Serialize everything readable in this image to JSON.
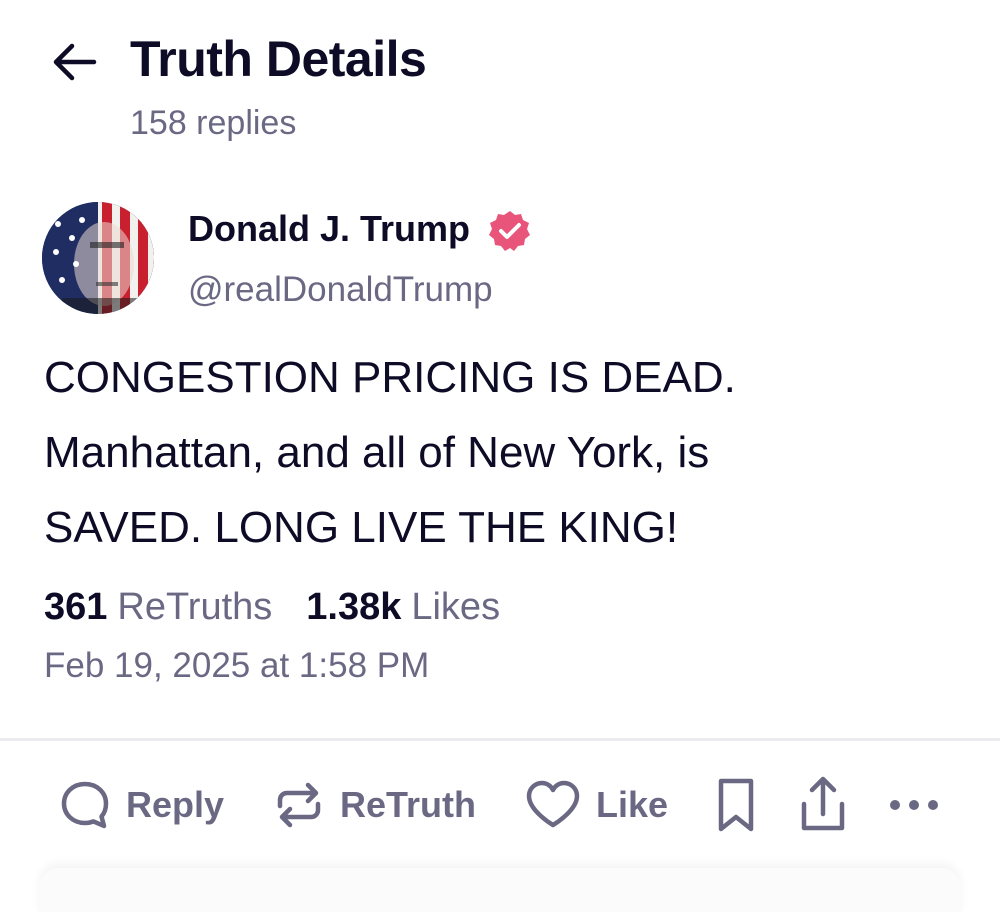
{
  "header": {
    "title": "Truth Details",
    "replies": "158 replies"
  },
  "author": {
    "name": "Donald J. Trump",
    "handle": "@realDonaldTrump",
    "verified_color": "#e8547a"
  },
  "post": {
    "lines": [
      "CONGESTION PRICING IS DEAD.",
      "Manhattan, and all of New York, is",
      "SAVED. LONG LIVE THE KING!"
    ]
  },
  "stats": {
    "retruths_count": "361",
    "retruths_label": "ReTruths",
    "likes_count": "1.38k",
    "likes_label": "Likes"
  },
  "timestamp": "Feb 19, 2025 at 1:58 PM",
  "actions": {
    "reply": "Reply",
    "retruth": "ReTruth",
    "like": "Like"
  },
  "icons": [
    "back-arrow-icon",
    "verified-badge-icon",
    "reply-icon",
    "retruth-icon",
    "heart-icon",
    "bookmark-icon",
    "share-icon",
    "more-icon"
  ]
}
